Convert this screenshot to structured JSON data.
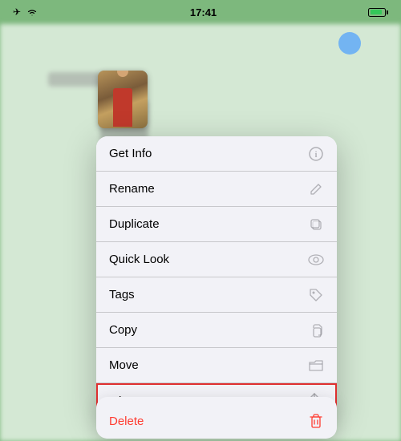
{
  "statusBar": {
    "time": "17:41",
    "signal": "signal",
    "wifi": "wifi",
    "battery": "battery"
  },
  "menu": {
    "items": [
      {
        "id": "get-info",
        "label": "Get Info",
        "icon": "info"
      },
      {
        "id": "rename",
        "label": "Rename",
        "icon": "pencil"
      },
      {
        "id": "duplicate",
        "label": "Duplicate",
        "icon": "duplicate"
      },
      {
        "id": "quick-look",
        "label": "Quick Look",
        "icon": "eye"
      },
      {
        "id": "tags",
        "label": "Tags",
        "icon": "tag"
      },
      {
        "id": "copy",
        "label": "Copy",
        "icon": "copy"
      },
      {
        "id": "move",
        "label": "Move",
        "icon": "folder"
      },
      {
        "id": "share",
        "label": "Share",
        "icon": "share",
        "highlighted": true
      }
    ],
    "deleteItem": {
      "id": "delete",
      "label": "Delete",
      "icon": "trash"
    }
  }
}
